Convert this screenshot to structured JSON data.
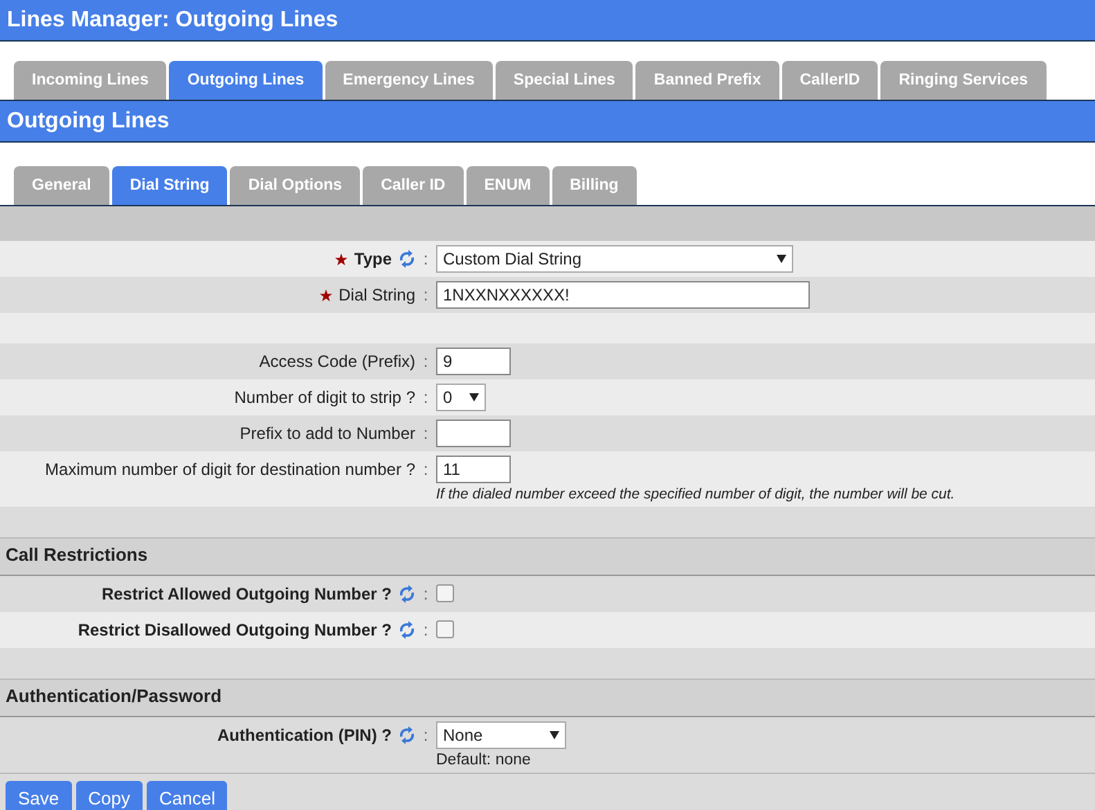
{
  "window": {
    "title": "Lines Manager:  Outgoing Lines"
  },
  "tabs": [
    {
      "label": "Incoming Lines",
      "selected": false
    },
    {
      "label": "Outgoing Lines",
      "selected": true
    },
    {
      "label": "Emergency Lines",
      "selected": false
    },
    {
      "label": "Special Lines",
      "selected": false
    },
    {
      "label": "Banned Prefix",
      "selected": false
    },
    {
      "label": "CallerID",
      "selected": false
    },
    {
      "label": "Ringing Services",
      "selected": false
    }
  ],
  "section_title": "Outgoing Lines",
  "subtabs": [
    {
      "label": "General",
      "selected": false
    },
    {
      "label": "Dial String",
      "selected": true
    },
    {
      "label": "Dial Options",
      "selected": false
    },
    {
      "label": "Caller ID",
      "selected": false
    },
    {
      "label": "ENUM",
      "selected": false
    },
    {
      "label": "Billing",
      "selected": false
    }
  ],
  "rows": [
    {
      "kind": "field",
      "label": "Type",
      "required": true,
      "bold": true,
      "refresh": true,
      "separator": ":",
      "control": {
        "kind": "select",
        "value": "Custom Dial String"
      }
    },
    {
      "kind": "field",
      "label": "Dial String",
      "required": true,
      "bold": false,
      "refresh": false,
      "separator": ":",
      "control": {
        "kind": "input",
        "value": "1NXXNXXXXXX!"
      }
    },
    {
      "kind": "blank"
    },
    {
      "kind": "field",
      "label": "Access Code (Prefix)",
      "required": false,
      "bold": false,
      "refresh": false,
      "separator": ":",
      "control": {
        "kind": "input",
        "value": "9"
      }
    },
    {
      "kind": "field",
      "label": "Number of digit to strip ?",
      "required": false,
      "bold": false,
      "refresh": false,
      "separator": ":",
      "control": {
        "kind": "select",
        "value": "0"
      }
    },
    {
      "kind": "field",
      "label": "Prefix to add to Number",
      "required": false,
      "bold": false,
      "refresh": false,
      "separator": ":",
      "control": {
        "kind": "input"
      }
    },
    {
      "kind": "field",
      "label": "Maximum number of digit for destination number ?",
      "required": false,
      "bold": false,
      "refresh": false,
      "separator": ":",
      "control": {
        "kind": "input",
        "value": "11"
      },
      "note": "If the dialed number exceed the specified number of digit, the number will be cut."
    },
    {
      "kind": "blank"
    },
    {
      "kind": "section",
      "label": "Call Restrictions"
    },
    {
      "kind": "field",
      "label": "Restrict Allowed Outgoing Number ?",
      "required": false,
      "bold": true,
      "refresh": true,
      "separator": ":",
      "control": {
        "kind": "checkbox",
        "checked": false
      }
    },
    {
      "kind": "field",
      "label": "Restrict Disallowed Outgoing Number ?",
      "required": false,
      "bold": true,
      "refresh": true,
      "separator": ":",
      "control": {
        "kind": "checkbox",
        "checked": false
      }
    },
    {
      "kind": "blank"
    },
    {
      "kind": "section",
      "label": "Authentication/Password"
    },
    {
      "kind": "field",
      "label": "Authentication (PIN) ?",
      "required": false,
      "bold": true,
      "refresh": true,
      "separator": ":",
      "control": {
        "kind": "select",
        "value": "None"
      },
      "default": "Default: none"
    }
  ],
  "buttons": [
    "Save",
    "Copy",
    "Cancel"
  ]
}
